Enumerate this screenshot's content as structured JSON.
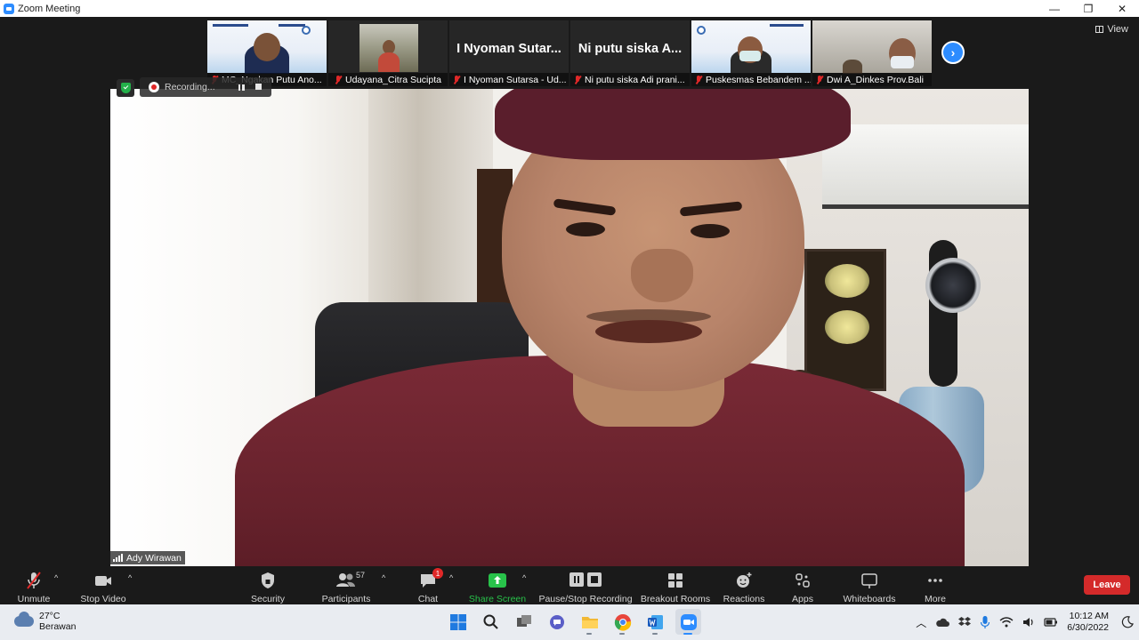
{
  "window": {
    "title": "Zoom Meeting",
    "controls": {
      "minimize": "—",
      "restore": "❐",
      "close": "✕"
    }
  },
  "view_button": {
    "label": "View"
  },
  "thumbnails": [
    {
      "name": "MC_Ngakan Putu Ano...",
      "type": "video-slide"
    },
    {
      "name": "Udayana_Citra Sucipta",
      "type": "video-photo"
    },
    {
      "name": "I Nyoman Sutarsa - Ud...",
      "display_name": "I Nyoman Sutar...",
      "type": "name-only"
    },
    {
      "name": "Ni putu siska Adi prani...",
      "display_name": "Ni putu siska A...",
      "type": "name-only"
    },
    {
      "name": "Puskesmas Bebandem ...",
      "type": "video-slide-mask"
    },
    {
      "name": "Dwi A_Dinkes Prov.Bali",
      "type": "video-person"
    }
  ],
  "recording": {
    "status": "Recording..."
  },
  "active_speaker": {
    "name": "Ady Wirawan"
  },
  "toolbar": {
    "unmute": "Unmute",
    "stop_video": "Stop Video",
    "security": "Security",
    "participants": "Participants",
    "participants_count": "57",
    "chat": "Chat",
    "chat_badge": "1",
    "share_screen": "Share Screen",
    "pause_stop_recording": "Pause/Stop Recording",
    "breakout_rooms": "Breakout Rooms",
    "reactions": "Reactions",
    "apps": "Apps",
    "whiteboards": "Whiteboards",
    "more": "More",
    "leave": "Leave"
  },
  "taskbar": {
    "weather_temp": "27°C",
    "weather_desc": "Berawan",
    "time": "10:12 AM",
    "date": "6/30/2022"
  },
  "colors": {
    "zoom_blue": "#2d8cff",
    "leave_red": "#d42a2a",
    "share_green": "#28c24a",
    "muted_red": "#e02828"
  }
}
